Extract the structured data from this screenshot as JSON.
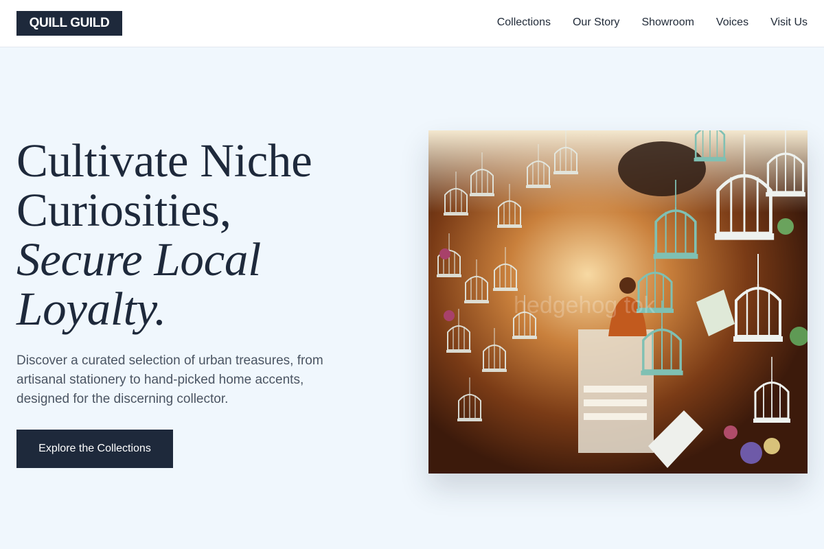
{
  "brand": {
    "logo_text": "QUILL GUILD"
  },
  "nav": {
    "items": [
      {
        "label": "Collections"
      },
      {
        "label": "Our Story"
      },
      {
        "label": "Showroom"
      },
      {
        "label": "Voices"
      },
      {
        "label": "Visit Us"
      }
    ]
  },
  "hero": {
    "headline": {
      "line1": "Cultivate Niche",
      "line2": "Curiosities,",
      "line3": "Secure Local",
      "line4": "Loyalty."
    },
    "description": "Discover a curated selection of urban treasures, from artisanal stationery to hand-picked home accents, designed for the discerning collector.",
    "cta_label": "Explore the Collections",
    "image": {
      "subject": "shop hung with white and teal ornamental birdcages and teapots",
      "watermark": "hedgehog tok"
    }
  },
  "colors": {
    "page_bg": "#f0f7fd",
    "header_bg": "#ffffff",
    "brand_dark": "#1e293b",
    "body_text": "#4b5563",
    "cage_white": "#e8efe9",
    "cage_teal": "#79b7ad",
    "warm_wall": "#a85a22"
  }
}
